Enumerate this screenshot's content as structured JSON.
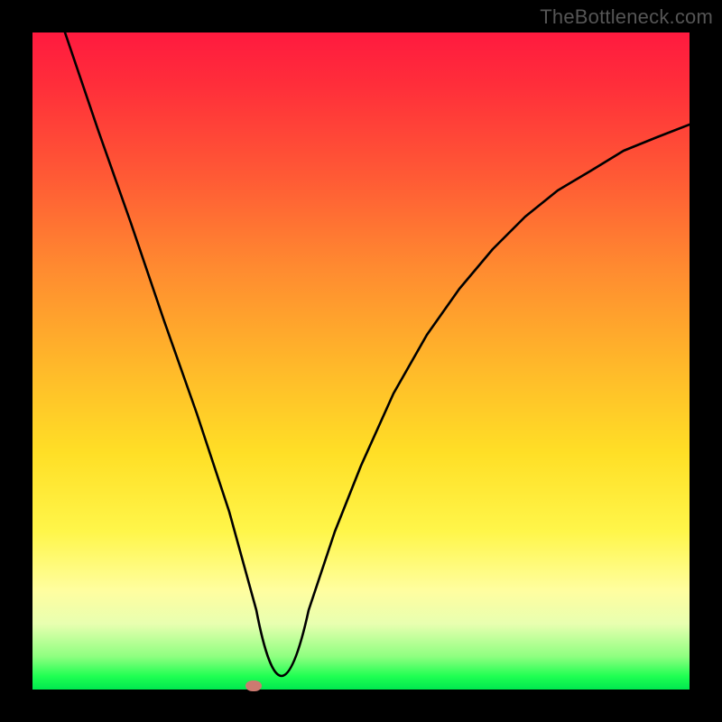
{
  "watermark": "TheBottleneck.com",
  "colors": {
    "frame": "#000000",
    "curve": "#000000",
    "gradient_top": "#ff1a3f",
    "gradient_bottom": "#00e84f",
    "min_point": "#cd7a70",
    "watermark_text": "#555555"
  },
  "chart_data": {
    "type": "line",
    "title": "",
    "xlabel": "",
    "ylabel": "",
    "xlim": [
      0,
      100
    ],
    "ylim": [
      0,
      100
    ],
    "grid": false,
    "legend": false,
    "series": [
      {
        "name": "bottleneck-curve",
        "x": [
          5,
          10,
          15,
          20,
          25,
          30,
          34,
          38,
          42,
          46,
          50,
          55,
          60,
          65,
          70,
          75,
          80,
          85,
          90,
          95,
          100
        ],
        "y": [
          100,
          85,
          71,
          56,
          42,
          27,
          12,
          2,
          12,
          24,
          34,
          45,
          54,
          61,
          67,
          72,
          76,
          79,
          82,
          84,
          86
        ]
      }
    ],
    "annotations": [
      {
        "type": "point",
        "name": "minimum",
        "x": 34,
        "y": 0
      }
    ]
  }
}
